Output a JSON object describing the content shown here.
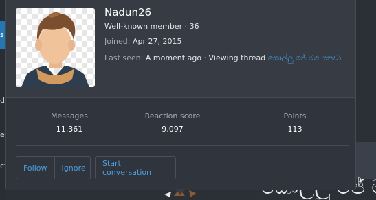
{
  "background": {
    "side_letters": [
      "s",
      "d",
      "e",
      "ct"
    ],
    "thread_title_fragment": "කොල්ලු ජේ ම"
  },
  "profile": {
    "username": "Nadun26",
    "title_line": "Well-known member · 36",
    "joined_label": "Joined:",
    "joined_value": "Apr 27, 2015",
    "last_seen_label": "Last seen:",
    "last_seen_value": "A moment ago · Viewing thread",
    "last_seen_link": "කොල්ලු ජේ මම යනවා",
    "avatar": "avatar-cartoon-man"
  },
  "stats": {
    "messages_label": "Messages",
    "messages_value": "11,361",
    "reaction_label": "Reaction score",
    "reaction_value": "9,097",
    "points_label": "Points",
    "points_value": "113"
  },
  "actions": {
    "follow": "Follow",
    "ignore": "Ignore",
    "start_conversation": "Start conversation"
  },
  "colors": {
    "popup_bg": "#363b44",
    "link": "#4a9fe0",
    "accent_tab": "#2577b1"
  }
}
